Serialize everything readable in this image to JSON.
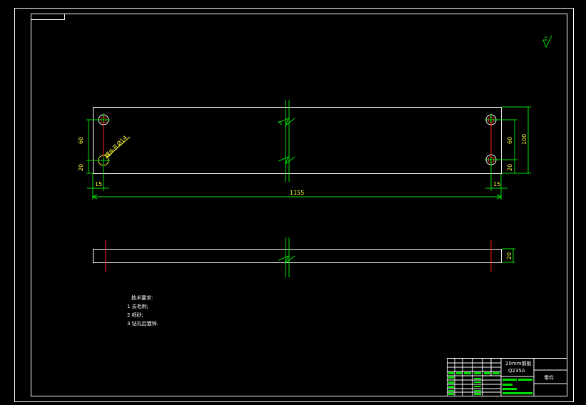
{
  "top_view": {
    "dim_height_left": "60",
    "dim_bottom_left": "20",
    "dim_height_right": "60",
    "dim_bottom_right": "20",
    "dim_overall_height": "100",
    "dim_edge_left": "15",
    "dim_edge_right": "15",
    "dim_length": "1155",
    "hole_callout": "埋头孔Ø14"
  },
  "side_view": {
    "dim_thickness": "20"
  },
  "notes": {
    "title": "技术要求:",
    "items": [
      "1 去毛刺;",
      "2 喷砂;",
      "3 钻孔后镀锌."
    ]
  },
  "title_block": {
    "part_name": "20mm钢板",
    "material": "Q235A",
    "label": "零件"
  },
  "colors": {
    "outline": "#ffffff",
    "centerline": "#00e000",
    "cut": "#ff2020",
    "dimension": "#ffff40"
  }
}
